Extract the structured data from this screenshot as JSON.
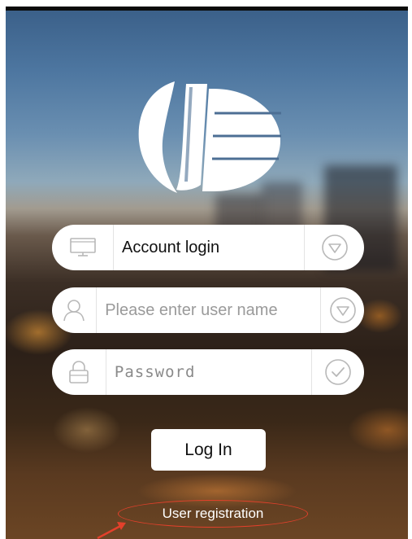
{
  "login_type": {
    "label": "Account login",
    "icon": "monitor-icon",
    "toggle_icon": "chevron-down-circle-icon"
  },
  "username": {
    "value": "",
    "placeholder": "Please enter user name",
    "icon": "user-icon",
    "toggle_icon": "chevron-down-circle-icon"
  },
  "password": {
    "value": "",
    "placeholder": "Password",
    "icon": "lock-icon",
    "check_icon": "check-circle-icon"
  },
  "login_button": {
    "label": "Log In"
  },
  "register_link": {
    "label": "User registration",
    "highlight_color": "#e3402b"
  }
}
